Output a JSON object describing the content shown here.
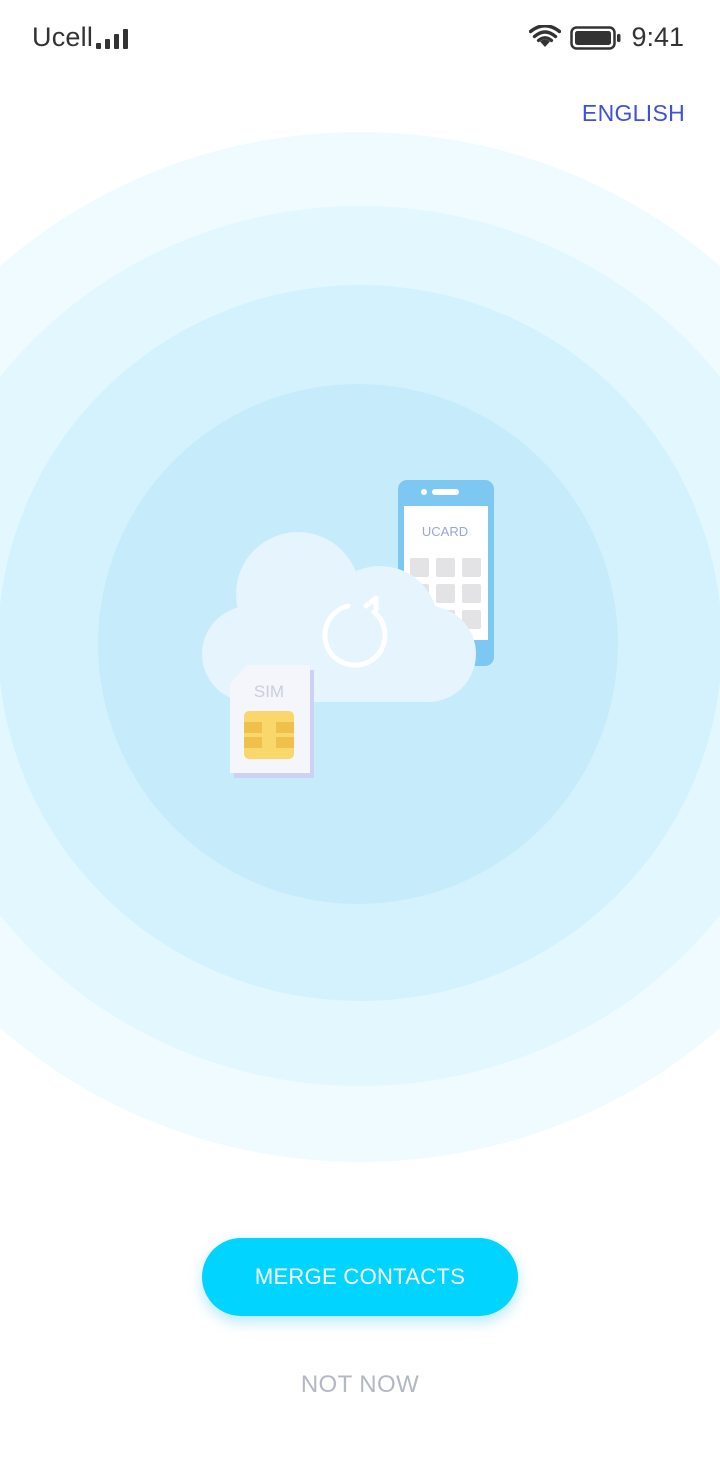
{
  "status_bar": {
    "carrier": "Ucell",
    "time": "9:41",
    "icons": [
      "signal-icon",
      "wifi-icon",
      "battery-icon"
    ]
  },
  "header": {
    "language_label": "ENGLISH"
  },
  "illustration": {
    "phone_label": "UCARD",
    "sim_label": "SIM",
    "icons": [
      "cloud-icon",
      "sync-icon",
      "phone-icon",
      "sim-card-icon"
    ]
  },
  "actions": {
    "primary_label": "MERGE CONTACTS",
    "secondary_label": "NOT NOW"
  },
  "colors": {
    "accent": "#00d4ff",
    "link": "#3f51d6",
    "muted": "#b3b8c2"
  }
}
